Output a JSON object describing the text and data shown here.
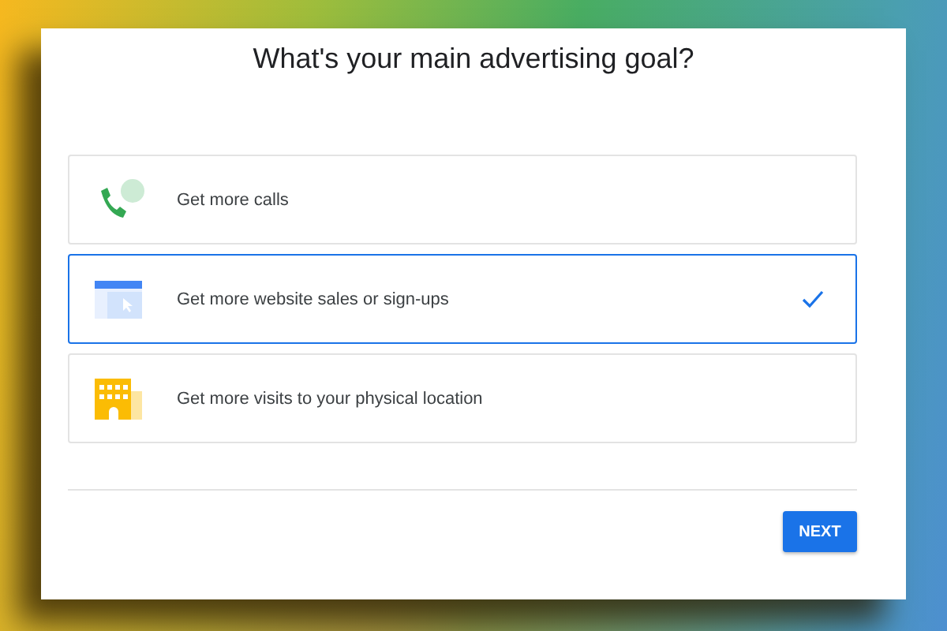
{
  "title": "What's your main advertising goal?",
  "options": [
    {
      "kind": "calls",
      "label": "Get more calls",
      "selected": false
    },
    {
      "kind": "website",
      "label": "Get more website sales or sign-ups",
      "selected": true
    },
    {
      "kind": "visits",
      "label": "Get more visits to your physical location",
      "selected": false
    }
  ],
  "next_button": "NEXT"
}
